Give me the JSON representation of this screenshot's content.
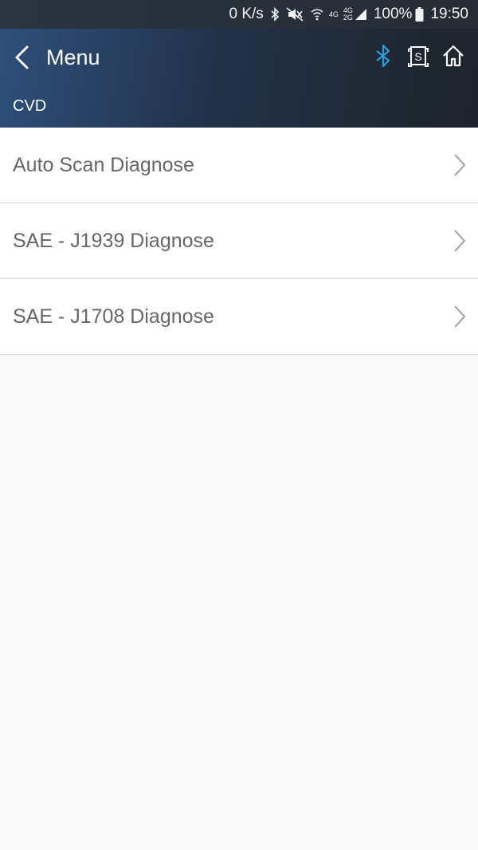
{
  "status_bar": {
    "speed": "0 K/s",
    "net_top": "4G",
    "net2_top": "4G",
    "net2_bottom": "2G",
    "battery": "100%",
    "time": "19:50"
  },
  "header": {
    "back_label": "Menu",
    "subtitle": "CVD",
    "bluetooth_color": "#2d9cdb",
    "icon_color": "#ffffff"
  },
  "menu": {
    "items": [
      {
        "label": "Auto Scan Diagnose"
      },
      {
        "label": "SAE - J1939 Diagnose"
      },
      {
        "label": "SAE - J1708 Diagnose"
      }
    ]
  }
}
